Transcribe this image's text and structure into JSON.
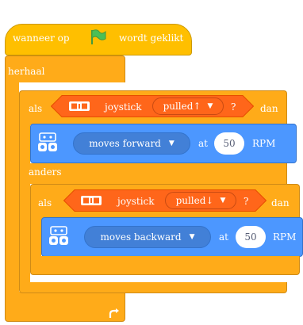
{
  "hat": {
    "prefix": "wanneer op",
    "flag_icon": "green-flag-icon",
    "suffix": "wordt geklikt"
  },
  "forever": {
    "label": "herhaal",
    "loop_icon": "loop-arrow-icon"
  },
  "if1": {
    "if_label": "als",
    "sensor_icon": "joystick-sensor-icon",
    "sensor_label": "joystick",
    "direction": "pulled↑",
    "question": "?",
    "then_label": "dan",
    "motor_icon": "robot-motor-icon",
    "action": "moves forward",
    "at_label": "at",
    "speed": "50",
    "unit": "RPM",
    "else_label": "anders"
  },
  "if2": {
    "if_label": "als",
    "sensor_icon": "joystick-sensor-icon",
    "sensor_label": "joystick",
    "direction": "pulled↓",
    "question": "?",
    "then_label": "dan",
    "motor_icon": "robot-motor-icon",
    "action": "moves backward",
    "at_label": "at",
    "speed": "50",
    "unit": "RPM"
  },
  "colors": {
    "control": "#ffab19",
    "events": "#ffbf00",
    "motion": "#4c97ff",
    "sensor": "#ff661a",
    "flag": "#4cbf56"
  }
}
